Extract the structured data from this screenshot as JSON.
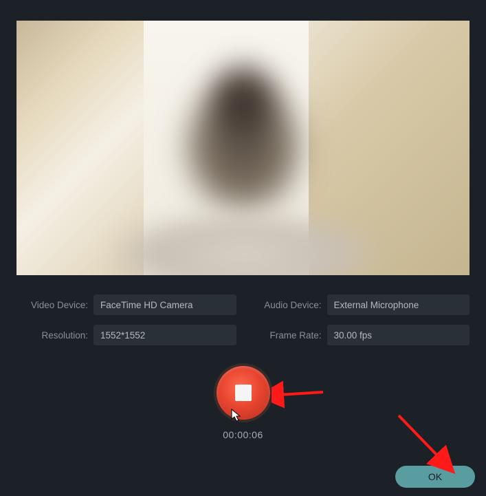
{
  "settings": {
    "video_device": {
      "label": "Video Device:",
      "value": "FaceTime HD Camera"
    },
    "audio_device": {
      "label": "Audio Device:",
      "value": "External Microphone"
    },
    "resolution": {
      "label": "Resolution:",
      "value": "1552*1552"
    },
    "frame_rate": {
      "label": "Frame Rate:",
      "value": "30.00 fps"
    }
  },
  "record": {
    "timer": "00:00:06"
  },
  "actions": {
    "ok": "OK"
  }
}
